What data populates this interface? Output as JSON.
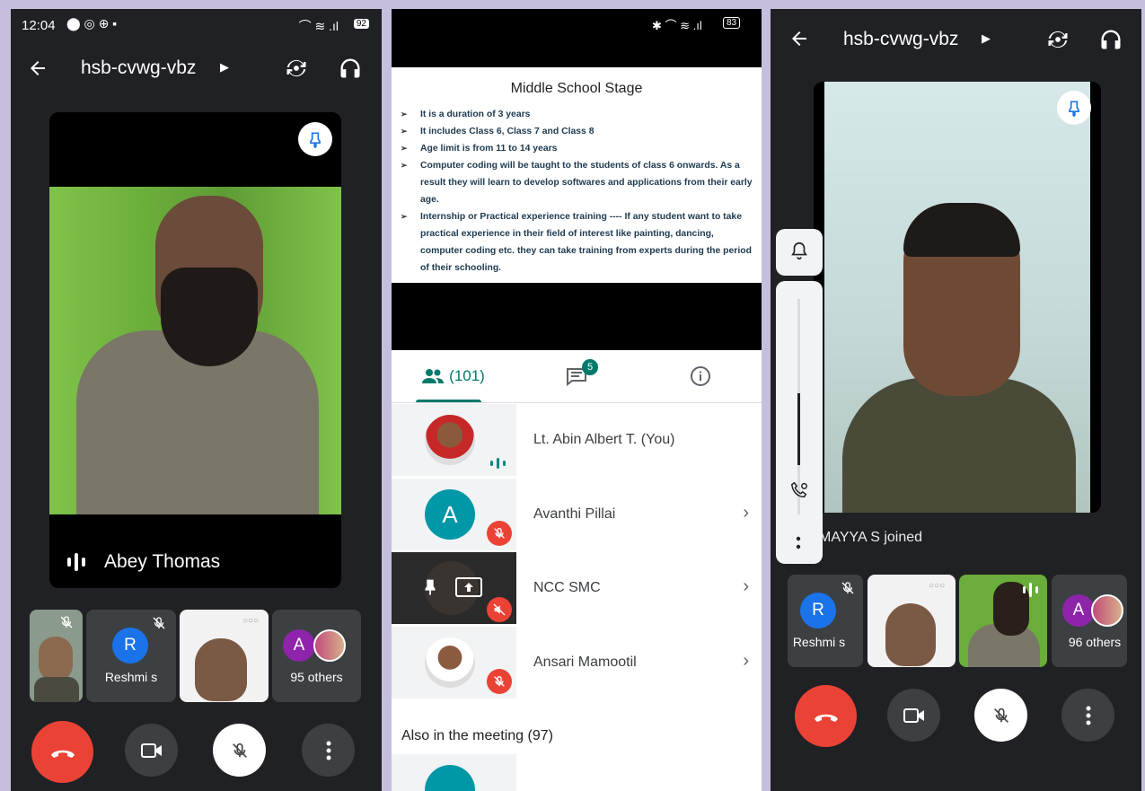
{
  "left": {
    "status_time": "12:04",
    "battery": "92",
    "meeting_code": "hsb-cvwg-vbz",
    "speaker_name": "Abey Thomas",
    "tiles": {
      "reshmi": "Reshmi s",
      "reshmi_initial": "R",
      "others": "95 others",
      "others_initial": "A"
    }
  },
  "middle": {
    "battery": "83",
    "slide": {
      "title": "Middle School Stage",
      "bullets": [
        "It is a duration of 3 years",
        "It includes Class 6, Class 7 and Class 8",
        "Age limit is from 11 to 14 years",
        "Computer coding will be taught to the students of class 6 onwards. As a result they will learn to develop softwares and applications from their early age.",
        "Internship or Practical experience training ---- If any student want to take practical experience in their field of interest like painting, dancing, computer coding etc. they can take training from experts during the period of their schooling."
      ]
    },
    "tabs": {
      "people_count": "(101)",
      "chat_badge": "5"
    },
    "participants": [
      {
        "name": "Lt. Abin Albert T. (You)"
      },
      {
        "name": "Avanthi Pillai",
        "initial": "A"
      },
      {
        "name": "NCC SMC"
      },
      {
        "name": "Ansari Mamootil"
      }
    ],
    "also_heading": "Also in the meeting (97)"
  },
  "right": {
    "meeting_code": "hsb-cvwg-vbz",
    "joined_toast": "MAYYA S joined",
    "tiles": {
      "reshmi": "Reshmi s",
      "reshmi_initial": "R",
      "others": "96 others",
      "others_initial": "A"
    }
  },
  "colors": {
    "accent_teal": "#00796b",
    "red": "#ea4335",
    "blue": "#1a73e8",
    "dark": "#202124"
  }
}
